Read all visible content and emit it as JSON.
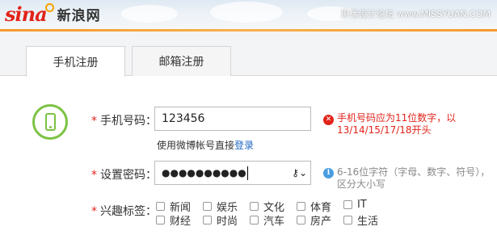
{
  "header": {
    "logo_mark": "sina",
    "logo_text": "新浪网",
    "watermark": "思缘设计论坛 www.MISSYUAN.COM"
  },
  "tabs": [
    {
      "label": "手机注册",
      "active": true
    },
    {
      "label": "邮箱注册",
      "active": false
    }
  ],
  "form": {
    "required_mark": "*",
    "phone_label": "手机号码：",
    "phone_value": "123456",
    "phone_hint_prefix": "使用微博帐号直接",
    "phone_hint_link": "登录",
    "phone_error": "手机号码应为11位数字，以13/14/15/17/18开头",
    "password_label": "设置密码：",
    "password_value": "●●●●●●●●●●",
    "password_info": "6-16位字符（字母、数字、符号），区分大小写",
    "interests_label": "兴趣标签：",
    "interests": [
      "新闻",
      "娱乐",
      "文化",
      "体育",
      "IT",
      "财经",
      "时尚",
      "汽车",
      "房产",
      "生活"
    ]
  },
  "icons": {
    "phone": "phone-icon",
    "error": "error-icon",
    "info": "info-icon",
    "key": "key-icon"
  },
  "colors": {
    "accent_orange": "#f59a2c",
    "error_red": "#e2231a",
    "link_blue": "#1f67c3",
    "phone_green": "#7cc243",
    "info_blue": "#4a9ee0"
  }
}
